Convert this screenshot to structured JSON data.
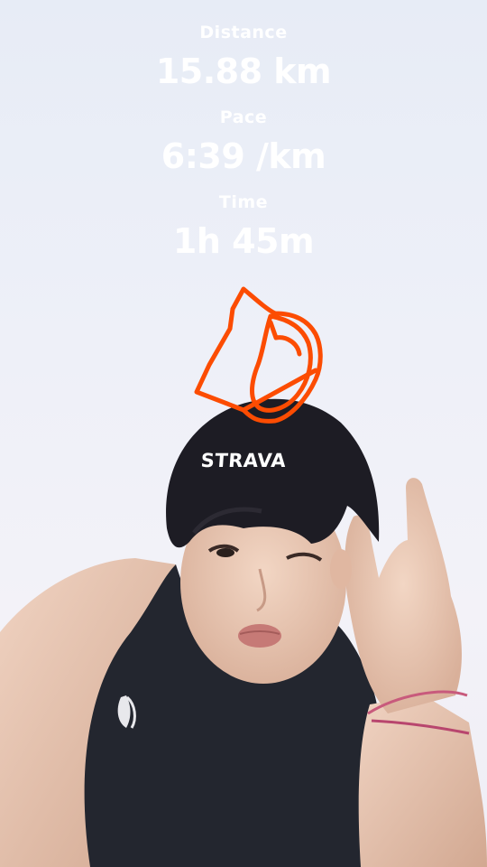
{
  "stats": [
    {
      "label": "Distance",
      "value": "15.88 km"
    },
    {
      "label": "Pace",
      "value": "6:39 /km"
    },
    {
      "label": "Time",
      "value": "1h 45m"
    }
  ],
  "brand": {
    "logo_text": "STRAVA"
  },
  "colors": {
    "route_orange": "#fc4c02",
    "overlay_text": "#ffffff",
    "sky": "#eceff8",
    "shirt": "#23262f"
  },
  "photo": {
    "shirt_logo_icon": "asics-logo-icon"
  }
}
